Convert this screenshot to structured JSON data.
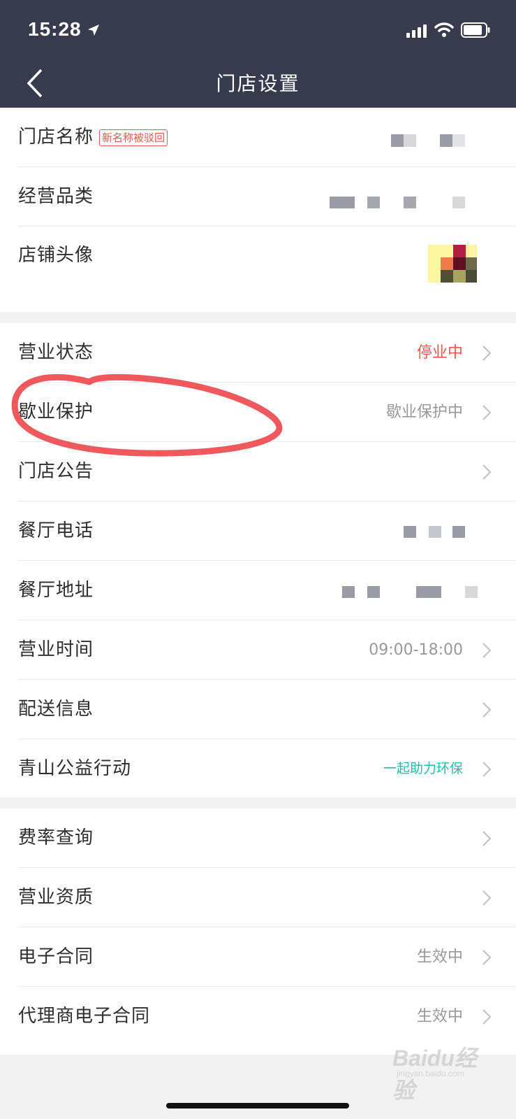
{
  "status_bar": {
    "time": "15:28"
  },
  "nav": {
    "title": "门店设置"
  },
  "group1": [
    {
      "label": "门店名称",
      "badge": "新名称被驳回"
    },
    {
      "label": "经营品类"
    },
    {
      "label": "店铺头像"
    }
  ],
  "group2": [
    {
      "label": "营业状态",
      "value": "停业中"
    },
    {
      "label": "歇业保护",
      "value": "歇业保护中"
    },
    {
      "label": "门店公告",
      "value": ""
    },
    {
      "label": "餐厅电话"
    },
    {
      "label": "餐厅地址"
    },
    {
      "label": "营业时间",
      "value": "09:00-18:00"
    },
    {
      "label": "配送信息",
      "value": ""
    },
    {
      "label": "青山公益行动",
      "value": "一起助力环保"
    }
  ],
  "group3": [
    {
      "label": "费率查询",
      "value": ""
    },
    {
      "label": "营业资质",
      "value": ""
    },
    {
      "label": "电子合同",
      "value": "生效中"
    },
    {
      "label": "代理商电子合同",
      "value": "生效中"
    }
  ],
  "colors": {
    "topbar": "#383b4e",
    "red": "#e8584d",
    "teal": "#1fbfb0",
    "annotation": "#ee4b4f"
  },
  "watermark": {
    "main": "Baidu经验",
    "sub": "jingyan.baidu.com"
  }
}
